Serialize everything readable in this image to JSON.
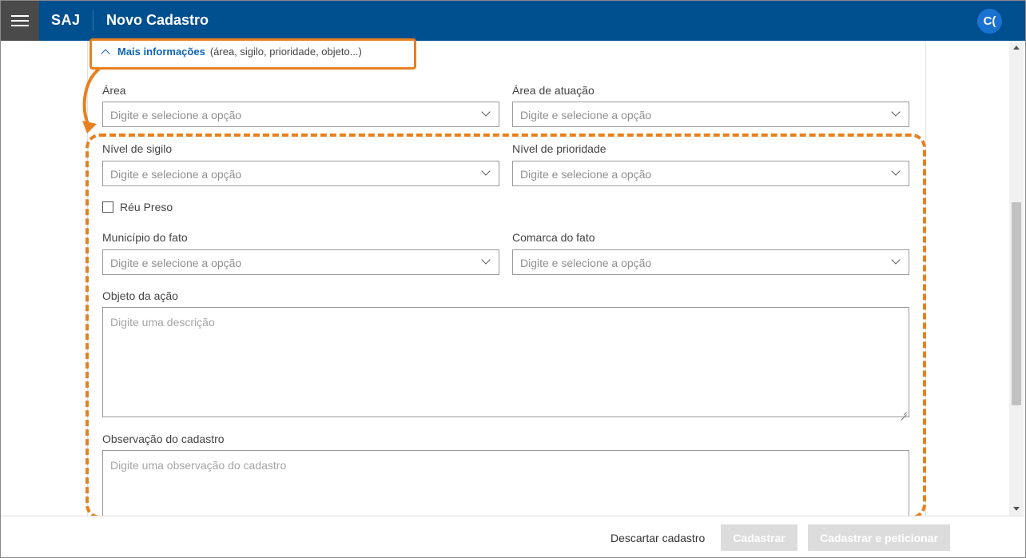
{
  "header": {
    "brand": "SAJ",
    "title": "Novo Cadastro",
    "avatar_initials": "C("
  },
  "more_info": {
    "link": "Mais informações",
    "hint": "(área, sigilo, prioridade, objeto...)"
  },
  "fields": {
    "area": {
      "label": "Área",
      "placeholder": "Digite e selecione a opção"
    },
    "area_atuacao": {
      "label": "Área de atuação",
      "placeholder": "Digite e selecione a opção"
    },
    "nivel_sigilo": {
      "label": "Nível de sigilo",
      "placeholder": "Digite e selecione a opção"
    },
    "nivel_prioridade": {
      "label": "Nível de prioridade",
      "placeholder": "Digite e selecione a opção"
    },
    "reu_preso": {
      "label": "Réu Preso",
      "checked": false
    },
    "municipio_fato": {
      "label": "Município do fato",
      "placeholder": "Digite e selecione a opção"
    },
    "comarca_fato": {
      "label": "Comarca do fato",
      "placeholder": "Digite e selecione a opção"
    },
    "objeto_acao": {
      "label": "Objeto da ação",
      "placeholder": "Digite uma descrição"
    },
    "observacao": {
      "label": "Observação do cadastro",
      "placeholder": "Digite uma observação do cadastro"
    }
  },
  "footer": {
    "discard": "Descartar cadastro",
    "submit": "Cadastrar",
    "submit_petition": "Cadastrar e peticionar"
  },
  "colors": {
    "header_bg": "#004f8f",
    "link": "#0b63b5",
    "annotation": "#e8801e",
    "disabled_button": "#dcdcdc"
  },
  "icons": [
    "menu-icon",
    "chevron-up-icon",
    "chevron-down-icon",
    "checkbox-icon",
    "resize-handle-icon"
  ]
}
